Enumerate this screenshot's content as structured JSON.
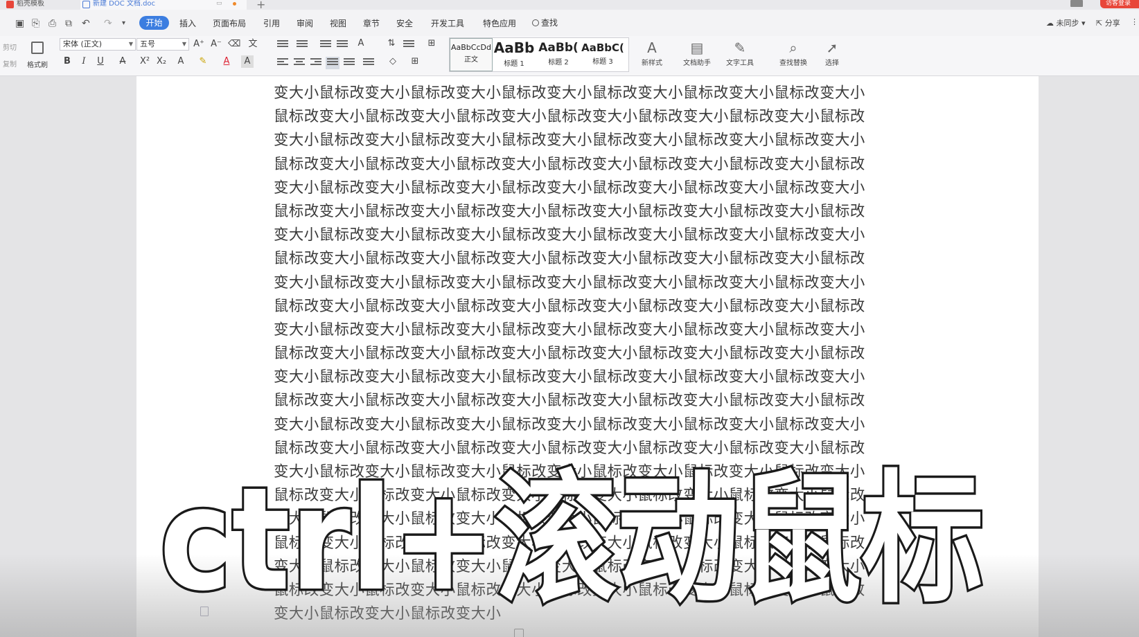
{
  "tabs": [
    {
      "label": "稻壳模板"
    },
    {
      "label": "新建 DOC 文档.doc"
    }
  ],
  "login_label": "访客登录",
  "menu": {
    "items": [
      "开始",
      "插入",
      "页面布局",
      "引用",
      "审阅",
      "视图",
      "章节",
      "安全",
      "开发工具",
      "特色应用"
    ],
    "search_label": "查找",
    "sync_label": "未同步",
    "share_label": "分享"
  },
  "ribbon": {
    "cut_label": "剪切",
    "copy_label": "复制",
    "format_brush_label": "格式刷",
    "font_name": "宋体 (正文)",
    "font_size": "五号",
    "styles": [
      {
        "preview": "AaBbCcDd",
        "name": "正文"
      },
      {
        "preview": "AaBb",
        "name": "标题 1"
      },
      {
        "preview": "AaBb(",
        "name": "标题 2"
      },
      {
        "preview": "AaBbC(",
        "name": "标题 3"
      }
    ],
    "new_style_label": "新样式",
    "doc_assistant_label": "文档助手",
    "text_tools_label": "文字工具",
    "find_replace_label": "查找替换",
    "select_label": "选择"
  },
  "document": {
    "lines": [
      "变大小鼠标改变大小鼠标改变大小鼠标改变大小鼠标改变大小鼠标改变大小鼠标改变大小",
      "鼠标改变大小鼠标改变大小鼠标改变大小鼠标改变大小鼠标改变大小鼠标改变大小鼠标改",
      "变大小鼠标改变大小鼠标改变大小鼠标改变大小鼠标改变大小鼠标改变大小鼠标改变大小",
      "鼠标改变大小鼠标改变大小鼠标改变大小鼠标改变大小鼠标改变大小鼠标改变大小鼠标改",
      "变大小鼠标改变大小鼠标改变大小鼠标改变大小鼠标改变大小鼠标改变大小鼠标改变大小",
      "鼠标改变大小鼠标改变大小鼠标改变大小鼠标改变大小鼠标改变大小鼠标改变大小鼠标改",
      "变大小鼠标改变大小鼠标改变大小鼠标改变大小鼠标改变大小鼠标改变大小鼠标改变大小",
      "鼠标改变大小鼠标改变大小鼠标改变大小鼠标改变大小鼠标改变大小鼠标改变大小鼠标改",
      "变大小鼠标改变大小鼠标改变大小鼠标改变大小鼠标改变大小鼠标改变大小鼠标改变大小",
      "鼠标改变大小鼠标改变大小鼠标改变大小鼠标改变大小鼠标改变大小鼠标改变大小鼠标改",
      "变大小鼠标改变大小鼠标改变大小鼠标改变大小鼠标改变大小鼠标改变大小鼠标改变大小",
      "鼠标改变大小鼠标改变大小鼠标改变大小鼠标改变大小鼠标改变大小鼠标改变大小鼠标改",
      "变大小鼠标改变大小鼠标改变大小鼠标改变大小鼠标改变大小鼠标改变大小鼠标改变大小",
      "鼠标改变大小鼠标改变大小鼠标改变大小鼠标改变大小鼠标改变大小鼠标改变大小鼠标改",
      "变大小鼠标改变大小鼠标改变大小鼠标改变大小鼠标改变大小鼠标改变大小鼠标改变大小",
      "鼠标改变大小鼠标改变大小鼠标改变大小鼠标改变大小鼠标改变大小鼠标改变大小鼠标改",
      "变大小鼠标改变大小鼠标改变大小鼠标改变大小鼠标改变大小鼠标改变大小鼠标改变大小",
      "鼠标改变大小鼠标改变大小鼠标改变大小鼠标改变大小鼠标改变大小鼠标改变大小鼠标改",
      "变大小鼠标改变大小鼠标改变大小鼠标改变大小鼠标改变大小鼠标改变大小鼠标改变大小",
      "鼠标改变大小鼠标改变大小鼠标改变大小鼠标改变大小鼠标改变大小鼠标改变大小鼠标改",
      "变大小鼠标改变大小鼠标改变大小鼠标改变大小鼠标改变大小鼠标改变大小鼠标改变大小",
      "鼠标改变大小鼠标改变大小鼠标改变大小鼠标改变大小鼠标改变大小鼠标改变大小鼠标改",
      "变大小鼠标改变大小鼠标改变大小"
    ]
  },
  "overlay_caption": "ctrl+滚动鼠标",
  "colors": {
    "accent": "#3b7de0",
    "brand_red": "#e8463a"
  }
}
